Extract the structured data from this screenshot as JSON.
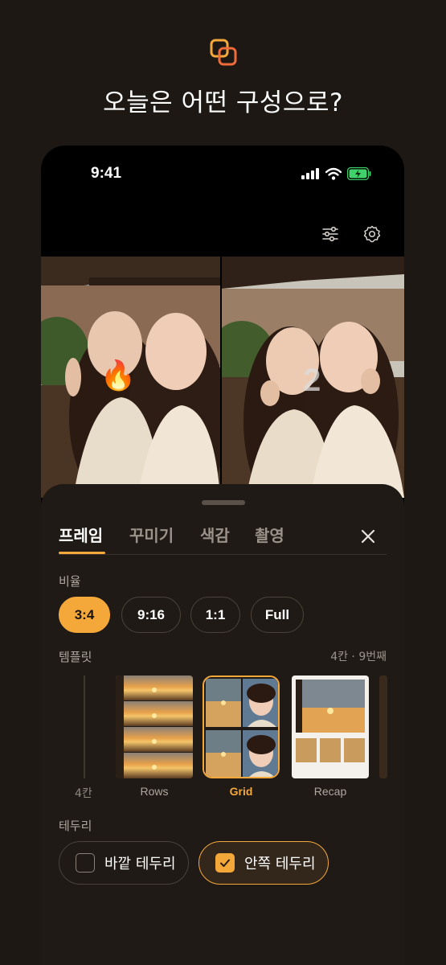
{
  "headline": "오늘은 어떤 구성으로?",
  "colors": {
    "accent": "#f5a83a",
    "background": "#1d1814",
    "sheet": "#1f1a16"
  },
  "status_bar": {
    "time": "9:41",
    "icons": [
      "signal-icon",
      "wifi-icon",
      "battery-charging-icon"
    ]
  },
  "camera_toolbar": {
    "icons": [
      "adjust-sliders-icon",
      "gear-icon"
    ]
  },
  "preview": {
    "frame_number": "2",
    "sticker": "fire-emoji"
  },
  "tabs": [
    {
      "label": "프레임",
      "active": true
    },
    {
      "label": "꾸미기",
      "active": false
    },
    {
      "label": "색감",
      "active": false
    },
    {
      "label": "촬영",
      "active": false
    }
  ],
  "ratio": {
    "label": "비율",
    "options": [
      {
        "label": "3:4",
        "active": true
      },
      {
        "label": "9:16",
        "active": false
      },
      {
        "label": "1:1",
        "active": false
      },
      {
        "label": "Full",
        "active": false
      }
    ]
  },
  "template": {
    "label": "템플릿",
    "count": "4칸 · 9번째",
    "slider_label": "4칸",
    "items": [
      {
        "name": "Rows",
        "selected": false
      },
      {
        "name": "Grid",
        "selected": true
      },
      {
        "name": "Recap",
        "selected": false
      }
    ]
  },
  "border": {
    "label": "테두리",
    "options": [
      {
        "label": "바깥 테두리",
        "checked": false
      },
      {
        "label": "안쪽 테두리",
        "checked": true
      }
    ]
  }
}
